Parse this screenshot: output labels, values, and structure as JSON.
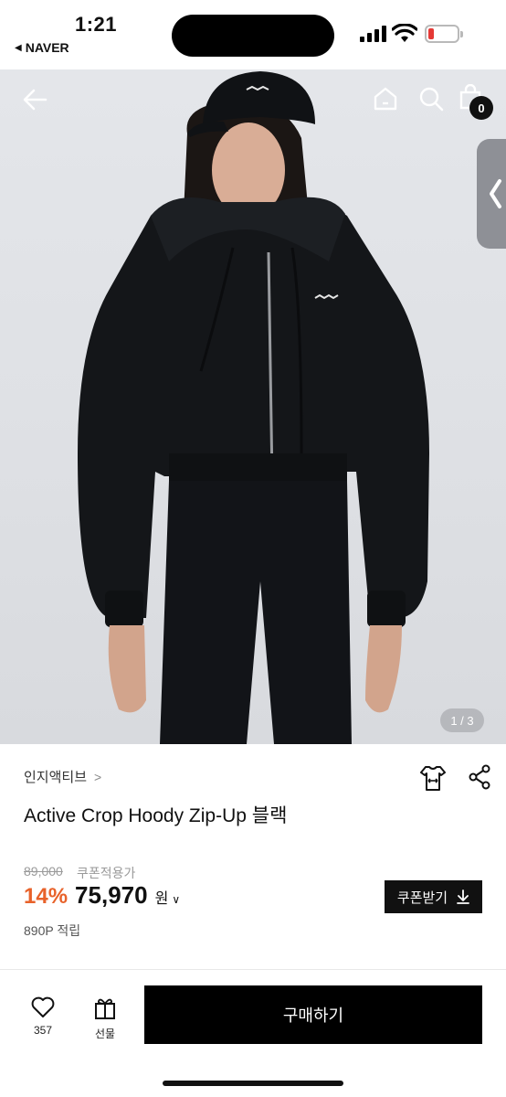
{
  "status_bar": {
    "time": "1:21",
    "back_app": "NAVER",
    "battery_color": "#e53935"
  },
  "hero": {
    "image_counter": "1 / 3",
    "cart_count": "0",
    "icons": [
      "back-arrow-icon",
      "home-icon",
      "search-icon",
      "shopping-bag-icon",
      "chevron-left-icon"
    ]
  },
  "product": {
    "brand": "인지액티브",
    "name": "Active Crop Hoody Zip-Up 블랙",
    "original_price": "89,000",
    "coupon_price_label": "쿠폰적용가",
    "discount": "14%",
    "price": "75,970",
    "currency": "원",
    "coupon_button": "쿠폰받기",
    "points": "890P 적립"
  },
  "bottom_bar": {
    "like_count": "357",
    "gift_label": "선물",
    "buy_label": "구매하기"
  },
  "colors": {
    "accent_discount": "#e8622a",
    "button_black": "#000000"
  }
}
